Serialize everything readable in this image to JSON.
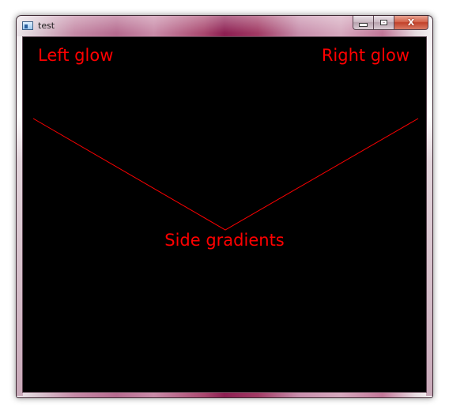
{
  "window": {
    "title": "test",
    "icon": "app-window-icon",
    "caption_buttons": {
      "minimize_icon": "minimize-icon",
      "maximize_icon": "maximize-icon",
      "close_glyph": "X"
    },
    "frame_accent": "#8d1f52"
  },
  "canvas": {
    "background": "#000000",
    "line_color": "#ff0000",
    "labels": {
      "left": "Left glow",
      "right": "Right glow",
      "center": "Side gradients"
    }
  }
}
